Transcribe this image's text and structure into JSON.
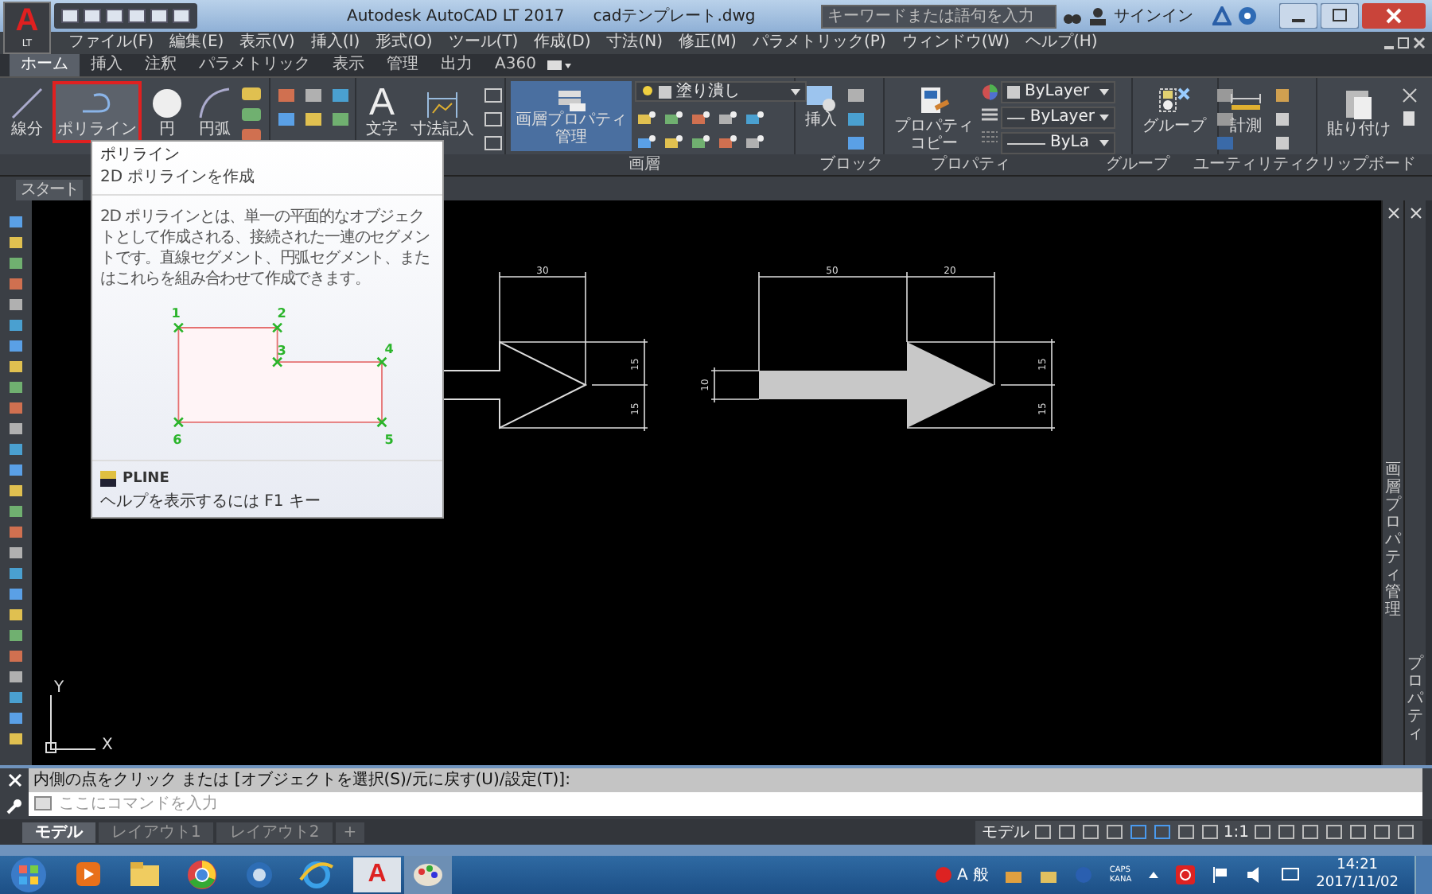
{
  "app_logo": {
    "letter": "A",
    "edition": "LT"
  },
  "window": {
    "app_name": "Autodesk AutoCAD LT 2017",
    "file_name": "cadテンプレート.dwg"
  },
  "search": {
    "placeholder": "キーワードまたは語句を入力"
  },
  "sign_in": "サインイン",
  "menu": [
    "ファイル(F)",
    "編集(E)",
    "表示(V)",
    "挿入(I)",
    "形式(O)",
    "ツール(T)",
    "作成(D)",
    "寸法(N)",
    "修正(M)",
    "パラメトリック(P)",
    "ウィンドウ(W)",
    "ヘルプ(H)"
  ],
  "ribbon_tabs": [
    {
      "label": "ホーム",
      "selected": true
    },
    {
      "label": "挿入",
      "selected": false
    },
    {
      "label": "注釈",
      "selected": false
    },
    {
      "label": "パラメトリック",
      "selected": false
    },
    {
      "label": "表示",
      "selected": false
    },
    {
      "label": "管理",
      "selected": false
    },
    {
      "label": "出力",
      "selected": false
    },
    {
      "label": "A360",
      "selected": false
    }
  ],
  "ribbon": {
    "draw_tools": [
      {
        "label": "線分",
        "selected": false
      },
      {
        "label": "ポリライン",
        "selected": true
      },
      {
        "label": "円",
        "selected": false
      },
      {
        "label": "円弧",
        "selected": false
      }
    ],
    "text_tool": {
      "glyph": "A",
      "label": "文字"
    },
    "dimension_tool": "寸法記入",
    "layer_properties": [
      "画層プロパティ",
      "管理"
    ],
    "layer_combo": "塗り潰し",
    "insert": "挿入",
    "match_properties": [
      "プロパティ",
      "コピー"
    ],
    "property_combos": [
      "ByLayer",
      "ByLayer",
      "ByLa"
    ],
    "group": "グループ",
    "measure": "計測",
    "paste": "貼り付け",
    "panels": [
      "画層",
      "ブロック",
      "プロパティ",
      "グループ",
      "ユーティリティ",
      "クリップボード"
    ]
  },
  "file_tab": "スタート",
  "tooltip": {
    "title": "ポリライン",
    "subtitle": "2D ポリラインを作成",
    "description": "2D ポリラインとは、単一の平面的なオブジェクトとして作成される、接続された一連のセグメントです。直線セグメント、円弧セグメント、またはこれらを組み合わせて作成できます。",
    "points": [
      "1",
      "2",
      "3",
      "4",
      "5",
      "6"
    ],
    "command": "PLINE",
    "help": "ヘルプを表示するには F1 キー"
  },
  "drawing": {
    "left_dims": [
      "30",
      "15",
      "15"
    ],
    "right_dims": [
      "50",
      "20",
      "10",
      "15",
      "15"
    ]
  },
  "ucs": {
    "x": "X",
    "y": "Y"
  },
  "palettes": [
    "画層プロパティ管理",
    "プロパティ"
  ],
  "command_line": {
    "prompt": "内側の点をクリック または [オブジェクトを選択(S)/元に戻す(U)/設定(T)]:",
    "placeholder": "ここにコマンドを入力"
  },
  "layout_tabs": [
    {
      "label": "モデル",
      "selected": true
    },
    {
      "label": "レイアウト1",
      "selected": false
    },
    {
      "label": "レイアウト2",
      "selected": false
    }
  ],
  "add_tab": "+",
  "status_bar": {
    "space": "モデル",
    "scale": "1:1"
  },
  "taskbar_app": {
    "letter": "A"
  },
  "tray": {
    "ime": [
      "A",
      "般"
    ],
    "keys": [
      "CAPS",
      "KANA"
    ],
    "time": "14:21",
    "date": "2017/11/02"
  }
}
